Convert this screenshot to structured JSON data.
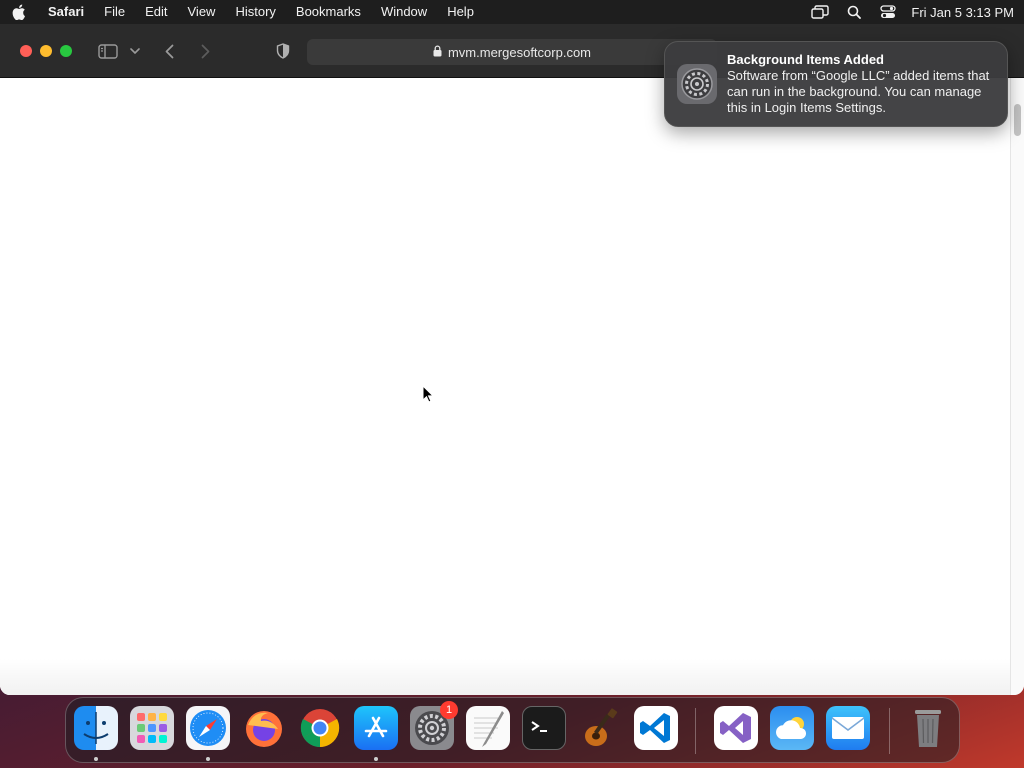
{
  "menubar": {
    "app_name": "Safari",
    "items": [
      "File",
      "Edit",
      "View",
      "History",
      "Bookmarks",
      "Window",
      "Help"
    ],
    "clock": "Fri Jan 5  3:13 PM"
  },
  "browser": {
    "url": "mvm.mergesoftcorp.com"
  },
  "notification": {
    "title": "Background Items Added",
    "body": "Software from “Google LLC” added items that can run in the background. You can manage this in Login Items Settings."
  },
  "dock": {
    "badge_count": "1",
    "apps": [
      "Finder",
      "Launchpad",
      "Safari",
      "Firefox",
      "Google Chrome",
      "App Store",
      "System Settings",
      "TextEdit",
      "Terminal",
      "GarageBand",
      "Visual Studio Code",
      "Visual Studio",
      "Weather",
      "Mail",
      "Trash"
    ]
  },
  "colors": {
    "close": "#ff5f57",
    "minimize": "#febc2e",
    "maximize": "#28c840",
    "badge": "#ff3b30"
  }
}
